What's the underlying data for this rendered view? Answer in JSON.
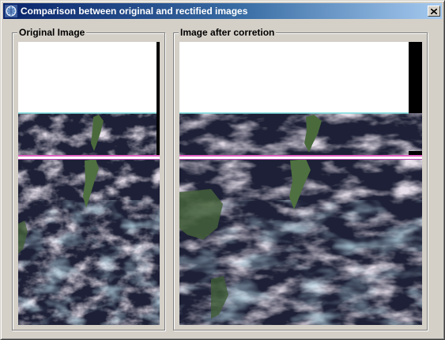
{
  "window": {
    "title": "Comparison between original and rectified images",
    "app_icon": "globe-icon",
    "close_icon": "close-icon"
  },
  "panels": {
    "original": {
      "label": "Original Image"
    },
    "corrected": {
      "label": "Image after corretion"
    }
  },
  "colors": {
    "titlebar_start": "#0a246a",
    "titlebar_end": "#a6caf0",
    "dialog_bg": "#d4d0c8",
    "ocean": "#1d2036",
    "cloud": "#c8b8cc",
    "cyan_cloud": "#8cc4dc",
    "land": "#4a6a3c",
    "stripe_pink": "#e060c0"
  }
}
